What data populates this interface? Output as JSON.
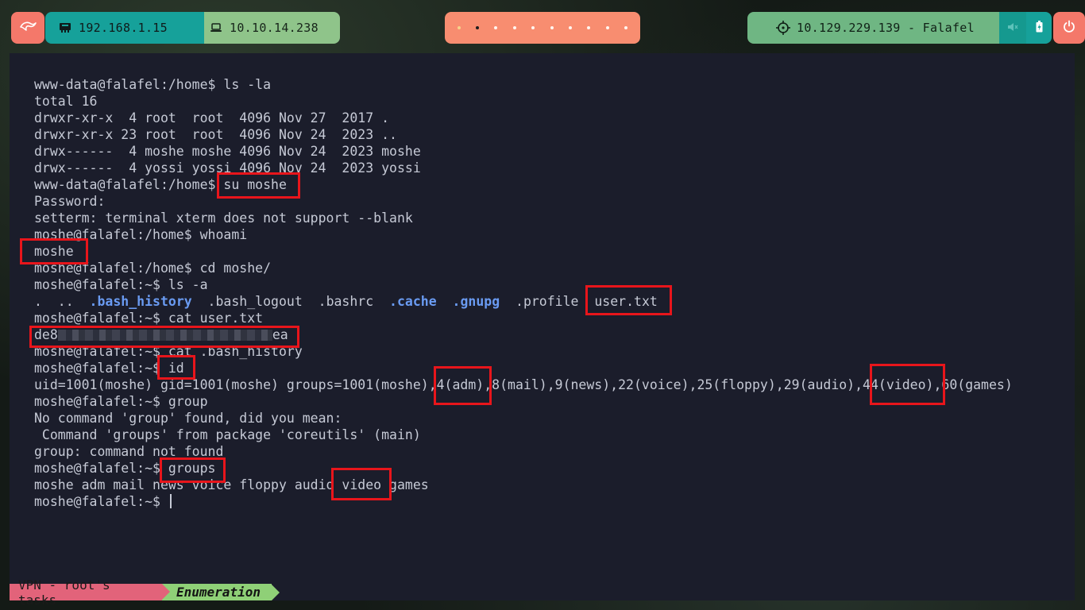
{
  "topbar": {
    "logo_icon": "kali-dragon-icon",
    "local_ip": "192.168.1.15",
    "local_ip_icon": "network-icon",
    "vpn_ip": "10.10.14.238",
    "vpn_ip_icon": "laptop-icon",
    "workspace_count": 10,
    "active_workspace": 2,
    "target": "10.129.229.139 - Falafel",
    "target_icon": "crosshair-icon",
    "volume_icon": "volume-muted-icon",
    "battery_icon": "battery-icon",
    "power_icon": "power-icon"
  },
  "terminal": {
    "lines": [
      "www-data@falafel:/home$ ls -la",
      "total 16",
      "drwxr-xr-x  4 root  root  4096 Nov 27  2017 .",
      "drwxr-xr-x 23 root  root  4096 Nov 24  2023 ..",
      "drwx------  4 moshe moshe 4096 Nov 24  2023 moshe",
      "drwx------  4 yossi yossi 4096 Nov 24  2023 yossi",
      "www-data@falafel:/home$ su moshe",
      "Password:",
      "setterm: terminal xterm does not support --blank",
      "moshe@falafel:/home$ whoami",
      "moshe",
      "moshe@falafel:/home$ cd moshe/",
      "moshe@falafel:~$ ls -a",
      {
        "segments": [
          {
            "text": ".  ..  ",
            "cls": ""
          },
          {
            "text": ".bash_history",
            "cls": "dir"
          },
          {
            "text": "  .bash_logout  .bashrc  ",
            "cls": ""
          },
          {
            "text": ".cache",
            "cls": "dir"
          },
          {
            "text": "  ",
            "cls": ""
          },
          {
            "text": ".gnupg",
            "cls": "dir"
          },
          {
            "text": "  .profile  user.txt",
            "cls": ""
          }
        ]
      },
      "moshe@falafel:~$ cat user.txt",
      {
        "segments": [
          {
            "text": "de8",
            "cls": ""
          },
          {
            "text": "",
            "cls": "blur",
            "chars": 27
          },
          {
            "text": "ea",
            "cls": ""
          }
        ]
      },
      "moshe@falafel:~$ cat .bash_history",
      "moshe@falafel:~$ id",
      "uid=1001(moshe) gid=1001(moshe) groups=1001(moshe),4(adm),8(mail),9(news),22(voice),25(floppy),29(audio),44(video),60(games)",
      "moshe@falafel:~$ group",
      "No command 'group' found, did you mean:",
      " Command 'groups' from package 'coreutils' (main)",
      "group: command not found",
      "moshe@falafel:~$ groups",
      "moshe adm mail news voice floppy audio video games",
      {
        "segments": [
          {
            "text": "moshe@falafel:~$ ",
            "cls": ""
          },
          {
            "text": "",
            "cls": "cursor"
          }
        ]
      }
    ]
  },
  "statusbar": {
    "session": "VPN - root's tasks",
    "window": "Enumeration"
  },
  "colors": {
    "terminal_bg": "#1b1d2b",
    "terminal_fg": "#c6cad6",
    "directory": "#6a9bf2",
    "highlight_box": "#e8151b"
  }
}
